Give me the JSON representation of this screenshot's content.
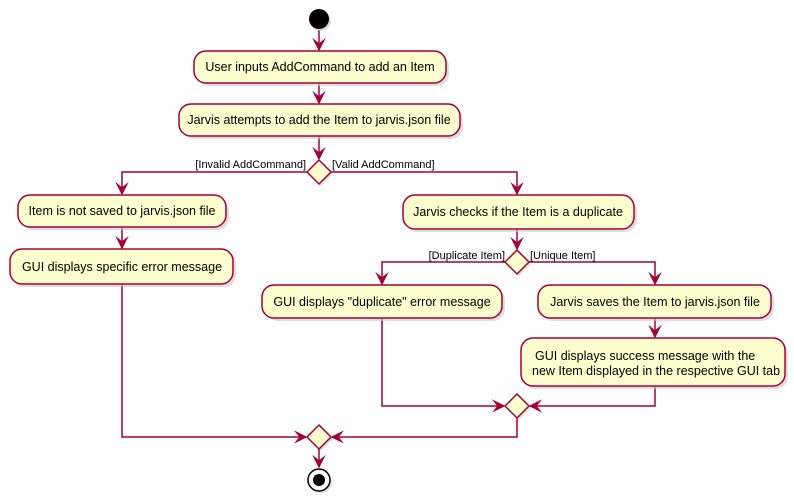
{
  "colors": {
    "fill": "#FEFECE",
    "stroke": "#A80036",
    "node": "#000000"
  },
  "activities": {
    "user_inputs": "User inputs AddCommand to add an Item",
    "attempt_add": "Jarvis attempts to add the Item to jarvis.json file",
    "not_saved": "Item is not saved to jarvis.json file",
    "error_msg": "GUI displays specific error message",
    "check_dup": "Jarvis checks if the Item is a duplicate",
    "dup_error": "GUI displays \"duplicate\" error message",
    "save_item": "Jarvis saves the Item to jarvis.json file",
    "success_line1": "GUI displays success message with the",
    "success_line2": "new Item displayed in the respective GUI tab"
  },
  "guards": {
    "invalid": "[Invalid AddCommand]",
    "valid": "[Valid AddCommand]",
    "duplicate": "[Duplicate Item]",
    "unique": "[Unique Item]"
  }
}
